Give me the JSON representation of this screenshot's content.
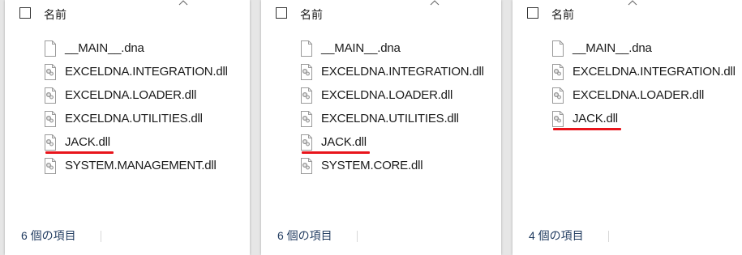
{
  "panels": [
    {
      "column_header": "名前",
      "files": [
        {
          "name": "__MAIN__.dna",
          "type": "dna",
          "highlight": false
        },
        {
          "name": "EXCELDNA.INTEGRATION.dll",
          "type": "dll",
          "highlight": false
        },
        {
          "name": "EXCELDNA.LOADER.dll",
          "type": "dll",
          "highlight": false
        },
        {
          "name": "EXCELDNA.UTILITIES.dll",
          "type": "dll",
          "highlight": false
        },
        {
          "name": "JACK.dll",
          "type": "dll",
          "highlight": true
        },
        {
          "name": "SYSTEM.MANAGEMENT.dll",
          "type": "dll",
          "highlight": false
        }
      ],
      "status": "6 個の項目"
    },
    {
      "column_header": "名前",
      "files": [
        {
          "name": "__MAIN__.dna",
          "type": "dna",
          "highlight": false
        },
        {
          "name": "EXCELDNA.INTEGRATION.dll",
          "type": "dll",
          "highlight": false
        },
        {
          "name": "EXCELDNA.LOADER.dll",
          "type": "dll",
          "highlight": false
        },
        {
          "name": "EXCELDNA.UTILITIES.dll",
          "type": "dll",
          "highlight": false
        },
        {
          "name": "JACK.dll",
          "type": "dll",
          "highlight": true
        },
        {
          "name": "SYSTEM.CORE.dll",
          "type": "dll",
          "highlight": false
        }
      ],
      "status": "6 個の項目"
    },
    {
      "column_header": "名前",
      "files": [
        {
          "name": "__MAIN__.dna",
          "type": "dna",
          "highlight": false
        },
        {
          "name": "EXCELDNA.INTEGRATION.dll",
          "type": "dll",
          "highlight": false
        },
        {
          "name": "EXCELDNA.LOADER.dll",
          "type": "dll",
          "highlight": false
        },
        {
          "name": "JACK.dll",
          "type": "dll",
          "highlight": true
        }
      ],
      "status": "4 個の項目"
    }
  ],
  "colors": {
    "highlight_underline": "#e8141b",
    "status_text": "#1f3a5f"
  },
  "icons": {
    "dna": "blank-file-icon",
    "dll": "dll-gear-file-icon"
  }
}
